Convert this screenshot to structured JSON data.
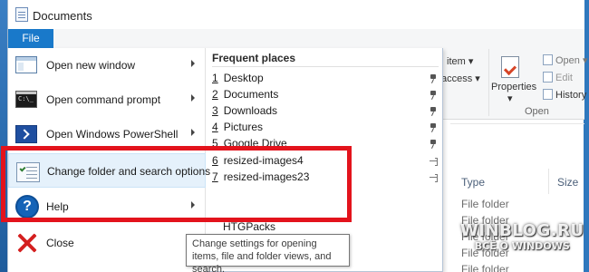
{
  "window": {
    "title": "Documents"
  },
  "ribbon": {
    "file_tab": "File",
    "item_label": "item",
    "access_label": "access",
    "properties_label": "Properties",
    "open_label": "Open",
    "edit_label": "Edit",
    "history_label": "History",
    "group_open": "Open"
  },
  "file_menu": {
    "items": [
      {
        "label": "Open new window",
        "icon": "window-icon",
        "has_submenu": true
      },
      {
        "label": "Open command prompt",
        "icon": "command-prompt-icon",
        "has_submenu": true
      },
      {
        "label": "Open Windows PowerShell",
        "icon": "powershell-icon",
        "has_submenu": true
      },
      {
        "label": "Change folder and search options",
        "icon": "folder-options-icon",
        "has_submenu": false
      },
      {
        "label": "Help",
        "icon": "help-icon",
        "has_submenu": true
      },
      {
        "label": "Close",
        "icon": "close-icon",
        "has_submenu": false
      }
    ],
    "frequent_places": {
      "header": "Frequent places",
      "items": [
        {
          "num": "1",
          "label": "Desktop",
          "pinned": true
        },
        {
          "num": "2",
          "label": "Documents",
          "pinned": true
        },
        {
          "num": "3",
          "label": "Downloads",
          "pinned": true
        },
        {
          "num": "4",
          "label": "Pictures",
          "pinned": true
        },
        {
          "num": "5",
          "label": "Google Drive",
          "pinned": true
        },
        {
          "num": "6",
          "label": "resized-images4",
          "pinned": false
        },
        {
          "num": "7",
          "label": "resized-images23",
          "pinned": false
        },
        {
          "num": "",
          "label": "HTGPacks",
          "pinned": false
        }
      ]
    },
    "tooltip": "Change settings for opening items, file and folder views, and search."
  },
  "content": {
    "columns": {
      "type": "Type",
      "size": "Size"
    },
    "rows": [
      "File folder",
      "File folder",
      "File folder",
      "File folder",
      "File folder"
    ]
  },
  "watermark": {
    "main": "WINBLOG.RU",
    "sub": "ВСЁ О WINDOWS"
  },
  "colors": {
    "accent": "#1979ca",
    "highlight_box": "#e3131c"
  }
}
